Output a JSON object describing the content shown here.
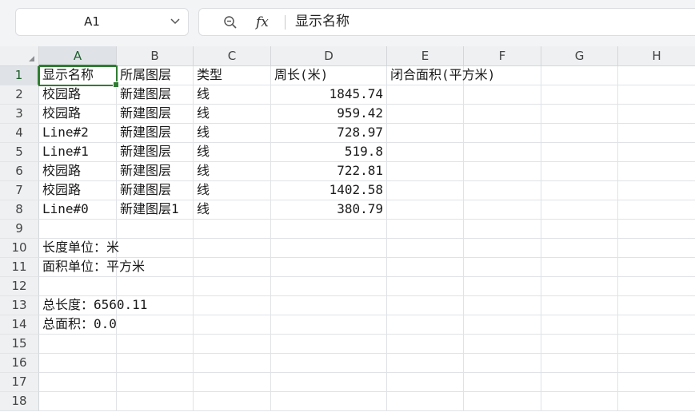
{
  "formula_bar": {
    "name_box": "A1",
    "formula_value": "显示名称"
  },
  "icons": {
    "dropdown": "chevron-down-icon",
    "zoom": "zoom-icon",
    "function": "fx-icon"
  },
  "colors": {
    "selection": "#2f7d32"
  },
  "sheet": {
    "columns": [
      "A",
      "B",
      "C",
      "D",
      "E",
      "F",
      "G",
      "H"
    ],
    "rows": [
      "1",
      "2",
      "3",
      "4",
      "5",
      "6",
      "7",
      "8",
      "9",
      "10",
      "11",
      "12",
      "13",
      "14",
      "15",
      "16",
      "17",
      "18"
    ],
    "active_cell": "A1",
    "cells": [
      {
        "ref": "A1",
        "value": "显示名称"
      },
      {
        "ref": "B1",
        "value": "所属图层"
      },
      {
        "ref": "C1",
        "value": "类型"
      },
      {
        "ref": "D1",
        "value": "周长(米)"
      },
      {
        "ref": "E1",
        "value": "闭合面积(平方米)"
      },
      {
        "ref": "A2",
        "value": "校园路"
      },
      {
        "ref": "B2",
        "value": "新建图层"
      },
      {
        "ref": "C2",
        "value": "线"
      },
      {
        "ref": "D2",
        "value": "1845.74",
        "numeric": true
      },
      {
        "ref": "A3",
        "value": "校园路"
      },
      {
        "ref": "B3",
        "value": "新建图层"
      },
      {
        "ref": "C3",
        "value": "线"
      },
      {
        "ref": "D3",
        "value": "959.42",
        "numeric": true
      },
      {
        "ref": "A4",
        "value": "Line#2"
      },
      {
        "ref": "B4",
        "value": "新建图层"
      },
      {
        "ref": "C4",
        "value": "线"
      },
      {
        "ref": "D4",
        "value": "728.97",
        "numeric": true
      },
      {
        "ref": "A5",
        "value": "Line#1"
      },
      {
        "ref": "B5",
        "value": "新建图层"
      },
      {
        "ref": "C5",
        "value": "线"
      },
      {
        "ref": "D5",
        "value": "519.8",
        "numeric": true
      },
      {
        "ref": "A6",
        "value": "校园路"
      },
      {
        "ref": "B6",
        "value": "新建图层"
      },
      {
        "ref": "C6",
        "value": "线"
      },
      {
        "ref": "D6",
        "value": "722.81",
        "numeric": true
      },
      {
        "ref": "A7",
        "value": "校园路"
      },
      {
        "ref": "B7",
        "value": "新建图层"
      },
      {
        "ref": "C7",
        "value": "线"
      },
      {
        "ref": "D7",
        "value": "1402.58",
        "numeric": true
      },
      {
        "ref": "A8",
        "value": "Line#0"
      },
      {
        "ref": "B8",
        "value": "新建图层1"
      },
      {
        "ref": "C8",
        "value": "线"
      },
      {
        "ref": "D8",
        "value": "380.79",
        "numeric": true
      },
      {
        "ref": "A10",
        "value": "长度单位：米"
      },
      {
        "ref": "A11",
        "value": "面积单位：平方米"
      },
      {
        "ref": "A13",
        "value": "总长度：6560.11"
      },
      {
        "ref": "A14",
        "value": "总面积：0.0"
      }
    ]
  }
}
